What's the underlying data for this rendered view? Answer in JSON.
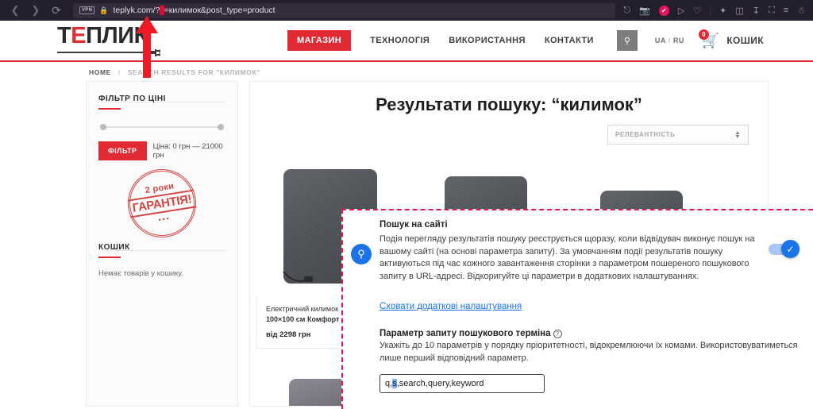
{
  "browser": {
    "back_icon": "back-arrow-icon",
    "forward_icon": "forward-arrow-icon",
    "reload_icon": "reload-icon",
    "vpn_badge": "VPN",
    "lock_icon": "lock-icon",
    "url_prefix": "teplyk.com/?",
    "url_highlight": "s",
    "url_suffix": "=килимок&post_type=product",
    "toolbar_icons": [
      "share-icon",
      "camera-icon",
      "shield-icon",
      "send-icon",
      "heart-icon",
      "extensions-icon",
      "package-icon",
      "download-icon",
      "battery-icon",
      "sliders-icon",
      "profile-icon"
    ]
  },
  "site": {
    "logo": {
      "part1": "Т",
      "part_red": "Е",
      "part2": "ПЛИК"
    },
    "nav": [
      {
        "label": "МАГАЗИН",
        "active": true
      },
      {
        "label": "ТЕХНОЛОГІЯ",
        "active": false
      },
      {
        "label": "ВИКОРИСТАННЯ",
        "active": false
      },
      {
        "label": "КОНТАКТИ",
        "active": false
      }
    ],
    "search_icon": "search-icon",
    "lang": {
      "ua": "UA",
      "sep": "/",
      "ru": "RU"
    },
    "cart": {
      "icon": "cart-icon",
      "count": "0",
      "label": "КОШИК"
    }
  },
  "breadcrumb": {
    "home": "HOME",
    "sep": "/",
    "current": "SEARCH RESULTS FOR \"КИЛИМОК\""
  },
  "sidebar": {
    "filter_title": "ФІЛЬТР ПО ЦІНІ",
    "filter_button": "ФІЛЬТР",
    "price_text": "Ціна: 0 грн — 21000 грн",
    "stamp": {
      "line1": "2 роки",
      "line2": "ГАРАНТІЯ!",
      "dots": "•••"
    },
    "cart_title": "КОШИК",
    "cart_empty": "Немає товарів у кошику."
  },
  "results": {
    "title": "Результати пошуку: “килимок”",
    "sort_value": "РЕЛЕВАНТНІСТЬ",
    "products": [
      {
        "name_line1": "Електричний килимок",
        "name_line2": "100×100 см Комфорт",
        "price": "від 2298 грн"
      }
    ]
  },
  "overlay": {
    "search_icon": "search-icon",
    "title": "Пошук на сайті",
    "description": "Подія перегляду результатів пошуку реєструється щоразу, коли відвідувач виконує пошук на вашому сайті (на основі параметра запиту). За умовчанням події результатів пошуку активуються під час кожного завантаження сторінки з параметром пошереного пошукового запиту в URL-адресі. Відкоригуйте ці параметри в додаткових налаштуваннях.",
    "toggle_on": true,
    "toggle_icon": "check-icon",
    "link": "Сховати додаткові налаштування",
    "field_label": "Параметр запиту пошукового терміна",
    "help_icon": "help-icon",
    "field_hint": "Укажіть до 10 параметрів у порядку пріоритетності, відокремлюючи їх комами. Використовуватиметься лише перший відповідний параметр.",
    "input_before": "q,",
    "input_selected": "s",
    "input_after": ",search,query,keyword"
  },
  "annotation": {
    "arrow_color": "#ee1b24",
    "arrow_icon": "up-arrow-annotation"
  },
  "colors": {
    "brand_red": "#e02b35",
    "google_blue": "#1a73e8",
    "overlay_border": "#e8154a",
    "chrome_bg": "#241f2e"
  }
}
